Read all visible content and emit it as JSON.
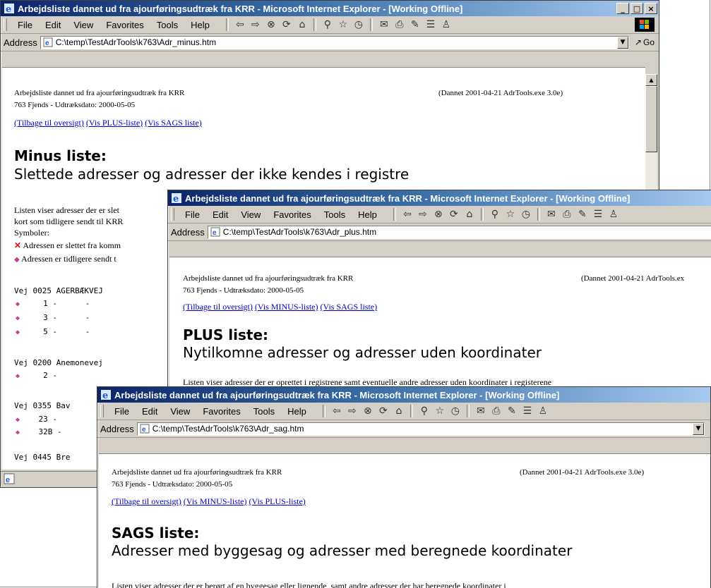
{
  "toolbar_menu": [
    "File",
    "Edit",
    "View",
    "Favorites",
    "Tools",
    "Help"
  ],
  "address_label": "Address",
  "go_label": "Go",
  "win1": {
    "title": "Arbejdsliste dannet ud fra ajourføringsudtræk fra KRR - Microsoft Internet Explorer - [Working Offline]",
    "address": "C:\\temp\\TestAdrTools\\k763\\Adr_minus.htm",
    "header_left_1": "Arbejdsliste dannet ud fra ajourføringsudtræk fra KRR",
    "header_left_2": "763 Fjends - Udtræksdato: 2000-05-05",
    "header_right": "(Dannet 2001-04-21 AdrTools.exe 3.0e)",
    "links": [
      "(Tilbage til oversigt)",
      "(Vis PLUS-liste)",
      "(Vis SAGS liste)"
    ],
    "heading": "Minus liste:",
    "subheading": "Slettede adresser og adresser der ikke kendes i registre",
    "intro_1": "Listen viser adresser der er slet",
    "intro_2": "kort som tidligere sendt til KRR",
    "symbols_label": "Symboler:",
    "symbol_x_text": "Adressen er slettet fra komm",
    "symbol_d_text": "Adressen er tidligere sendt t",
    "lines": {
      "vej1": "Vej 0025 AGERBÆKVEJ",
      "r1": "1 -      -",
      "r2": "3 -      -",
      "r3": "5 -      -",
      "vej2": "Vej 0200 Anemonevej",
      "r4": "2 -",
      "vej3": "Vej 0355 Bav",
      "r5": "23 -",
      "r6": "32B -",
      "vej4": "Vej 0445 Bre"
    }
  },
  "win2": {
    "title": "Arbejdsliste dannet ud fra ajourføringsudtræk fra KRR - Microsoft Internet Explorer - [Working Offline]",
    "address": "C:\\temp\\TestAdrTools\\k763\\Adr_plus.htm",
    "header_left_1": "Arbejdsliste dannet ud fra ajourføringsudtræk fra KRR",
    "header_left_2": "763 Fjends - Udtræksdato: 2000-05-05",
    "header_right": "(Dannet 2001-04-21 AdrTools.ex",
    "links": [
      "(Tilbage til oversigt)",
      "(Vis MINUS-liste)",
      "(Vis SAGS liste)"
    ],
    "heading": "PLUS liste:",
    "subheading": "Nytilkomne adresser og adresser uden koordinater",
    "intro_1": "Listen viser adresser der er oprettet i registrene samt eventuelle andre adresser uden koordinater i registerene"
  },
  "win3": {
    "title": "Arbejdsliste dannet ud fra ajourføringsudtræk fra KRR - Microsoft Internet Explorer - [Working Offline]",
    "address": "C:\\temp\\TestAdrTools\\k763\\Adr_sag.htm",
    "header_left_1": "Arbejdsliste dannet ud fra ajourføringsudtræk fra KRR",
    "header_left_2": "763 Fjends - Udtræksdato: 2000-05-05",
    "header_right": "(Dannet 2001-04-21 AdrTools.exe 3.0e)",
    "links": [
      "(Tilbage til oversigt)",
      "(Vis MINUS-liste)",
      "(Vis PLUS-liste)"
    ],
    "heading": "SAGS liste:",
    "subheading": "Adresser med byggesag og adresser med beregnede koordinater",
    "intro_1": "Listen viser adresser der er berørt af en byggesag eller lignende, samt andre adresser der har beregnede koordinater i"
  }
}
